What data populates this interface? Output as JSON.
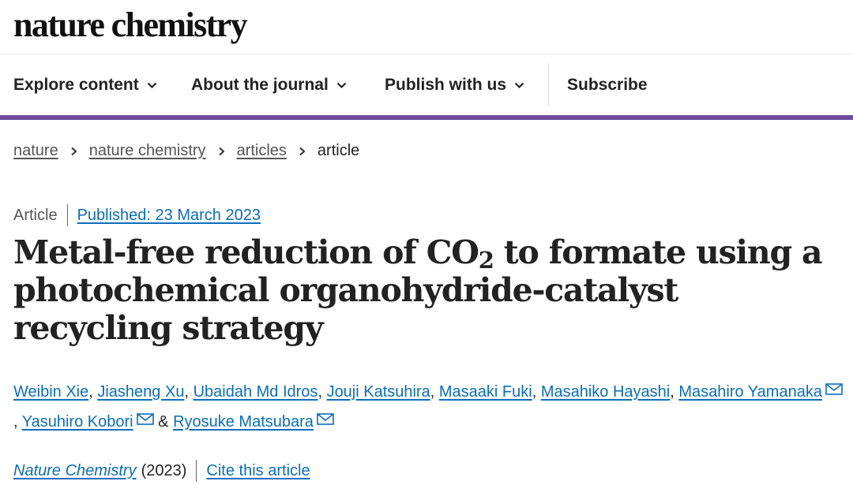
{
  "site": {
    "logo_text": "nature chemistry"
  },
  "nav": {
    "items": [
      {
        "label": "Explore content"
      },
      {
        "label": "About the journal"
      },
      {
        "label": "Publish with us"
      }
    ],
    "subscribe_label": "Subscribe",
    "accent_color": "#6b4c9a"
  },
  "breadcrumb": [
    {
      "label": "nature"
    },
    {
      "label": "nature chemistry"
    },
    {
      "label": "articles"
    },
    {
      "label": "article"
    }
  ],
  "article": {
    "type": "Article",
    "published_label": "Published: 23 March 2023",
    "title_part1": "Metal-free reduction of CO",
    "title_sub": "2",
    "title_part2": " to formate using a photochemical organohydride-catalyst recycling strategy",
    "authors": [
      {
        "name": "Weibin Xie"
      },
      {
        "name": "Jiasheng Xu"
      },
      {
        "name": "Ubaidah Md Idros"
      },
      {
        "name": "Jouji Katsuhira"
      },
      {
        "name": "Masaaki Fuki"
      },
      {
        "name": "Masahiko Hayashi"
      },
      {
        "name": "Masahiro Yamanaka"
      },
      {
        "name": "Yasuhiro Kobori"
      },
      {
        "name": "Ryosuke Matsubara"
      }
    ],
    "author_separator": ",",
    "author_ampersand": "&",
    "journal_name": "Nature Chemistry",
    "year": "(2023)",
    "cite_label": "Cite this article",
    "link_color": "#0a6ebd"
  },
  "icons": {
    "nav_chevron": "chevron-down-icon",
    "breadcrumb_arrow": "chevron-right-icon",
    "author_email": "mail-icon"
  }
}
